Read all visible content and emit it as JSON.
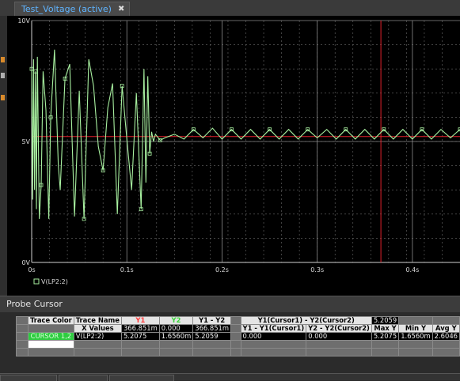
{
  "window": {
    "tab_label": "Test_Voltage (active)",
    "close_glyph": "✖"
  },
  "chart_data": {
    "type": "line",
    "ylim": [
      0,
      10
    ],
    "xlim": [
      0,
      0.45
    ],
    "y_ticks": [
      {
        "value": 10,
        "label": "10V"
      },
      {
        "value": 5,
        "label": "5V"
      },
      {
        "value": 0,
        "label": "0V"
      }
    ],
    "x_ticks": [
      {
        "value": 0,
        "label": "0s"
      },
      {
        "value": 0.1,
        "label": "0.1s"
      },
      {
        "value": 0.2,
        "label": "0.2s"
      },
      {
        "value": 0.3,
        "label": "0.3s"
      },
      {
        "value": 0.4,
        "label": "0.4s"
      }
    ],
    "grid": true,
    "legend": "bottom-left",
    "cursor_x": 0.3669,
    "cursor_y": 5.2059,
    "series": [
      {
        "name": "V(LP2:2)",
        "color": "#a8f0a0",
        "x": [
          0,
          0.001,
          0.002,
          0.003,
          0.004,
          0.005,
          0.006,
          0.008,
          0.01,
          0.012,
          0.015,
          0.018,
          0.02,
          0.024,
          0.028,
          0.03,
          0.035,
          0.04,
          0.045,
          0.05,
          0.055,
          0.06,
          0.065,
          0.07,
          0.075,
          0.08,
          0.085,
          0.09,
          0.095,
          0.1,
          0.105,
          0.11,
          0.115,
          0.118,
          0.12,
          0.122,
          0.124,
          0.126,
          0.128,
          0.13,
          0.135,
          0.14,
          0.15,
          0.16,
          0.17,
          0.18,
          0.19,
          0.2,
          0.21,
          0.22,
          0.23,
          0.24,
          0.25,
          0.26,
          0.27,
          0.28,
          0.29,
          0.3,
          0.31,
          0.32,
          0.33,
          0.34,
          0.35,
          0.36,
          0.37,
          0.38,
          0.39,
          0.4,
          0.41,
          0.42,
          0.43,
          0.44,
          0.45
        ],
        "y": [
          8.0,
          2.6,
          8.4,
          3.0,
          7.9,
          2.2,
          8.5,
          1.8,
          3.2,
          7.9,
          6.3,
          1.8,
          6.0,
          8.8,
          4.0,
          3.0,
          7.6,
          8.2,
          1.9,
          7.1,
          1.8,
          8.4,
          7.3,
          4.8,
          3.8,
          6.4,
          7.4,
          2.0,
          7.3,
          5.1,
          3.0,
          7.0,
          2.2,
          8.0,
          3.3,
          7.7,
          4.5,
          5.4,
          5.0,
          5.3,
          5.05,
          5.15,
          5.3,
          5.1,
          5.5,
          5.15,
          5.55,
          5.1,
          5.5,
          5.1,
          5.5,
          5.1,
          5.5,
          5.1,
          5.5,
          5.1,
          5.5,
          5.15,
          5.5,
          5.1,
          5.5,
          5.1,
          5.5,
          5.1,
          5.5,
          5.1,
          5.5,
          5.1,
          5.5,
          5.1,
          5.5,
          5.15,
          5.5
        ]
      }
    ]
  },
  "probe": {
    "title": "Probe Cursor",
    "headers": {
      "trace_color": "Trace Color",
      "trace_name": "Trace Name",
      "y1": "Y1",
      "y2": "Y2",
      "y1_minus_y2": "Y1 - Y2",
      "cursor_diff": "Y1(Cursor1) - Y2(Cursor2)",
      "x_values": "X Values",
      "y1_cursor_diff": "Y1 - Y1(Cursor1)",
      "y2_cursor_diff": "Y2 - Y2(Cursor2)",
      "max_y": "Max Y",
      "min_y": "Min Y",
      "avg_y": "Avg Y"
    },
    "cursor_diff_value": "5.2059",
    "x_row": {
      "y1": "366.851m",
      "y2": "0.000",
      "diff": "366.851m"
    },
    "trace_row": {
      "cursor": "CURSOR 1,2",
      "name": "V(LP2:2)",
      "y1": "5.2075",
      "y2": "1.6560m",
      "diff": "5.2059",
      "y1c": "0.000",
      "y2c": "0.000",
      "max": "5.2075",
      "min": "1.6560m",
      "avg": "2.6046"
    }
  }
}
